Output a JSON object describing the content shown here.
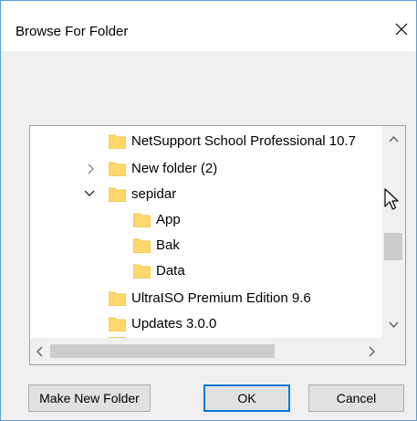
{
  "window": {
    "title": "Browse For Folder",
    "close_glyph": "✕"
  },
  "tree": {
    "items": [
      {
        "label": "NetSupport School Professional 10.7",
        "level": 1,
        "expander": "none"
      },
      {
        "label": "New folder (2)",
        "level": 1,
        "expander": "collapsed"
      },
      {
        "label": "sepidar",
        "level": 1,
        "expander": "expanded"
      },
      {
        "label": "App",
        "level": 2,
        "expander": "none"
      },
      {
        "label": "Bak",
        "level": 2,
        "expander": "none"
      },
      {
        "label": "Data",
        "level": 2,
        "expander": "none"
      },
      {
        "label": "UltraISO Premium Edition 9.6",
        "level": 1,
        "expander": "none"
      },
      {
        "label": "Updates 3.0.0",
        "level": 1,
        "expander": "none"
      }
    ]
  },
  "buttons": {
    "make_new_folder": "Make New Folder",
    "ok": "OK",
    "cancel": "Cancel"
  },
  "icons": {
    "folder": "folder-icon",
    "close": "close-icon",
    "scroll_up": "scroll-up-arrow-icon",
    "scroll_down": "scroll-down-arrow-icon",
    "scroll_left": "scroll-left-arrow-icon",
    "scroll_right": "scroll-right-arrow-icon",
    "cursor": "mouse-pointer-icon"
  },
  "colors": {
    "folder_fill": "#ffd86b",
    "folder_tab": "#e8b93c",
    "accent": "#0078d7",
    "window_border": "#5c9fd6"
  }
}
